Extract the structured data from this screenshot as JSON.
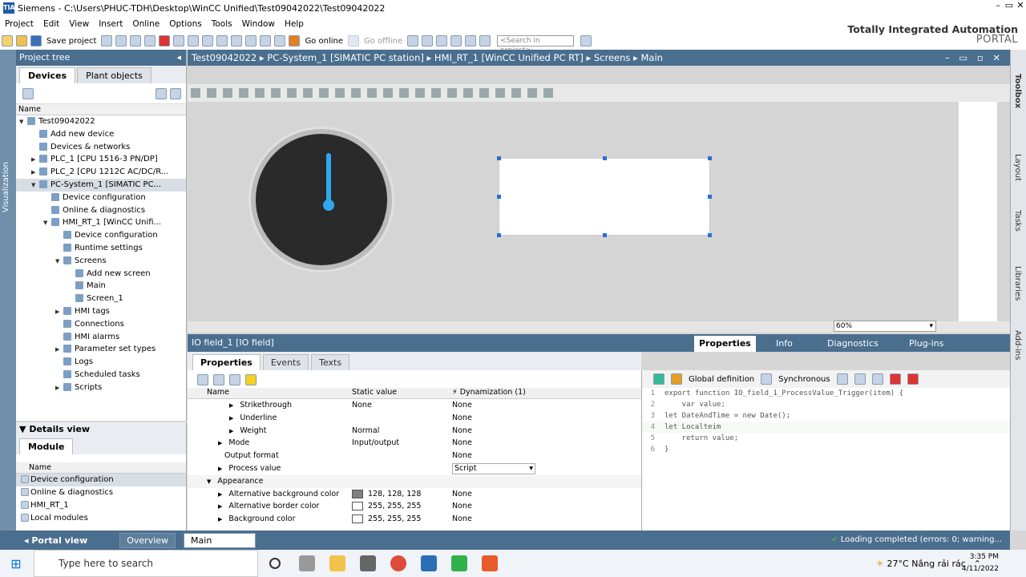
{
  "window": {
    "title": "Siemens  -  C:\\Users\\PHUC-TDH\\Desktop\\WinCC Unified\\Test09042022\\Test09042022"
  },
  "menu": [
    "Project",
    "Edit",
    "View",
    "Insert",
    "Online",
    "Options",
    "Tools",
    "Window",
    "Help"
  ],
  "toolbar": {
    "save_label": "Save project",
    "go_online": "Go online",
    "go_offline": "Go offline",
    "search_placeholder": "<Search in project>"
  },
  "brand": {
    "line1": "Totally Integrated Automation",
    "line2": "PORTAL"
  },
  "side_tab": "Visualization",
  "project_tree": {
    "title": "Project tree",
    "tabs": [
      "Devices",
      "Plant objects"
    ],
    "column": "Name",
    "items": [
      {
        "label": "Test09042022",
        "indent": 0,
        "arrow": "▼"
      },
      {
        "label": "Add new device",
        "indent": 1,
        "arrow": ""
      },
      {
        "label": "Devices & networks",
        "indent": 1,
        "arrow": ""
      },
      {
        "label": "PLC_1 [CPU 1516-3 PN/DP]",
        "indent": 1,
        "arrow": "▶"
      },
      {
        "label": "PLC_2 [CPU 1212C AC/DC/R...",
        "indent": 1,
        "arrow": "▶"
      },
      {
        "label": "PC-System_1 [SIMATIC PC...",
        "indent": 1,
        "arrow": "▼"
      },
      {
        "label": "Device configuration",
        "indent": 2,
        "arrow": ""
      },
      {
        "label": "Online & diagnostics",
        "indent": 2,
        "arrow": ""
      },
      {
        "label": "HMI_RT_1 [WinCC Unifi...",
        "indent": 2,
        "arrow": "▼"
      },
      {
        "label": "Device configuration",
        "indent": 3,
        "arrow": ""
      },
      {
        "label": "Runtime settings",
        "indent": 3,
        "arrow": ""
      },
      {
        "label": "Screens",
        "indent": 3,
        "arrow": "▼"
      },
      {
        "label": "Add new screen",
        "indent": 4,
        "arrow": ""
      },
      {
        "label": "Main",
        "indent": 4,
        "arrow": ""
      },
      {
        "label": "Screen_1",
        "indent": 4,
        "arrow": ""
      },
      {
        "label": "HMI tags",
        "indent": 3,
        "arrow": "▶"
      },
      {
        "label": "Connections",
        "indent": 3,
        "arrow": ""
      },
      {
        "label": "HMI alarms",
        "indent": 3,
        "arrow": ""
      },
      {
        "label": "Parameter set types",
        "indent": 3,
        "arrow": "▶"
      },
      {
        "label": "Logs",
        "indent": 3,
        "arrow": ""
      },
      {
        "label": "Scheduled tasks",
        "indent": 3,
        "arrow": ""
      },
      {
        "label": "Scripts",
        "indent": 3,
        "arrow": "▶"
      }
    ]
  },
  "details_view": {
    "title": "Details view",
    "tab": "Module",
    "column": "Name",
    "items": [
      "Device configuration",
      "Online & diagnostics",
      "HMI_RT_1",
      "Local modules"
    ]
  },
  "breadcrumb": "Test09042022  ▸  PC-System_1 [SIMATIC PC station]  ▸  HMI_RT_1 [WinCC Unified PC RT]  ▸  Screens  ▸  Main",
  "zoom": "60%",
  "right_tabs": [
    "Toolbox",
    "Layout",
    "Tasks",
    "Libraries",
    "Add-ins"
  ],
  "inspector": {
    "title": "IO field_1 [IO field]",
    "top_tabs": [
      "Properties",
      "Info",
      "Diagnostics",
      "Plug-ins"
    ],
    "tabs": [
      "Properties",
      "Events",
      "Texts"
    ],
    "columns": [
      "Name",
      "Static value",
      "Dynamization (1)"
    ],
    "rows": [
      {
        "name": "Strikethrough",
        "static": "None",
        "dyn": "None",
        "arrow": "▶",
        "indent": 2,
        "swatch": ""
      },
      {
        "name": "Underline",
        "static": "",
        "dyn": "None",
        "arrow": "▶",
        "indent": 2,
        "swatch": ""
      },
      {
        "name": "Weight",
        "static": "Normal",
        "dyn": "None",
        "arrow": "▶",
        "indent": 2,
        "swatch": ""
      },
      {
        "name": "Mode",
        "static": "Input/output",
        "dyn": "None",
        "arrow": "▶",
        "indent": 1,
        "swatch": ""
      },
      {
        "name": "Output format",
        "static": "",
        "dyn": "None",
        "arrow": "",
        "indent": 1,
        "swatch": ""
      },
      {
        "name": "Process value",
        "static": "",
        "dyn": "Script",
        "arrow": "▶",
        "indent": 1,
        "swatch": ""
      },
      {
        "name": "Appearance",
        "static": "",
        "dyn": "",
        "arrow": "▼",
        "indent": 0,
        "swatch": ""
      },
      {
        "name": "Alternative background color",
        "static": "128, 128, 128",
        "dyn": "None",
        "arrow": "▶",
        "indent": 1,
        "swatch": "#808080"
      },
      {
        "name": "Alternative border color",
        "static": "255, 255, 255",
        "dyn": "None",
        "arrow": "▶",
        "indent": 1,
        "swatch": "#ffffff"
      },
      {
        "name": "Background color",
        "static": "255, 255, 255",
        "dyn": "None",
        "arrow": "▶",
        "indent": 1,
        "swatch": "#ffffff"
      }
    ]
  },
  "script": {
    "tools": [
      "Global definition",
      "Synchronous"
    ],
    "lines": [
      "export function IO_field_1_ProcessValue_Trigger(item) {",
      "    var value;",
      "let DateAndTime = new Date();",
      "let Localteim",
      "    return value;",
      "}"
    ]
  },
  "status": {
    "portal_view": "Portal view",
    "overview": "Overview",
    "main": "Main",
    "message": "Loading completed (errors: 0; warning..."
  },
  "taskbar": {
    "search": "Type here to search",
    "weather": "27°C  Nắng rải rác",
    "time": "3:35 PM",
    "date": "4/11/2022"
  }
}
